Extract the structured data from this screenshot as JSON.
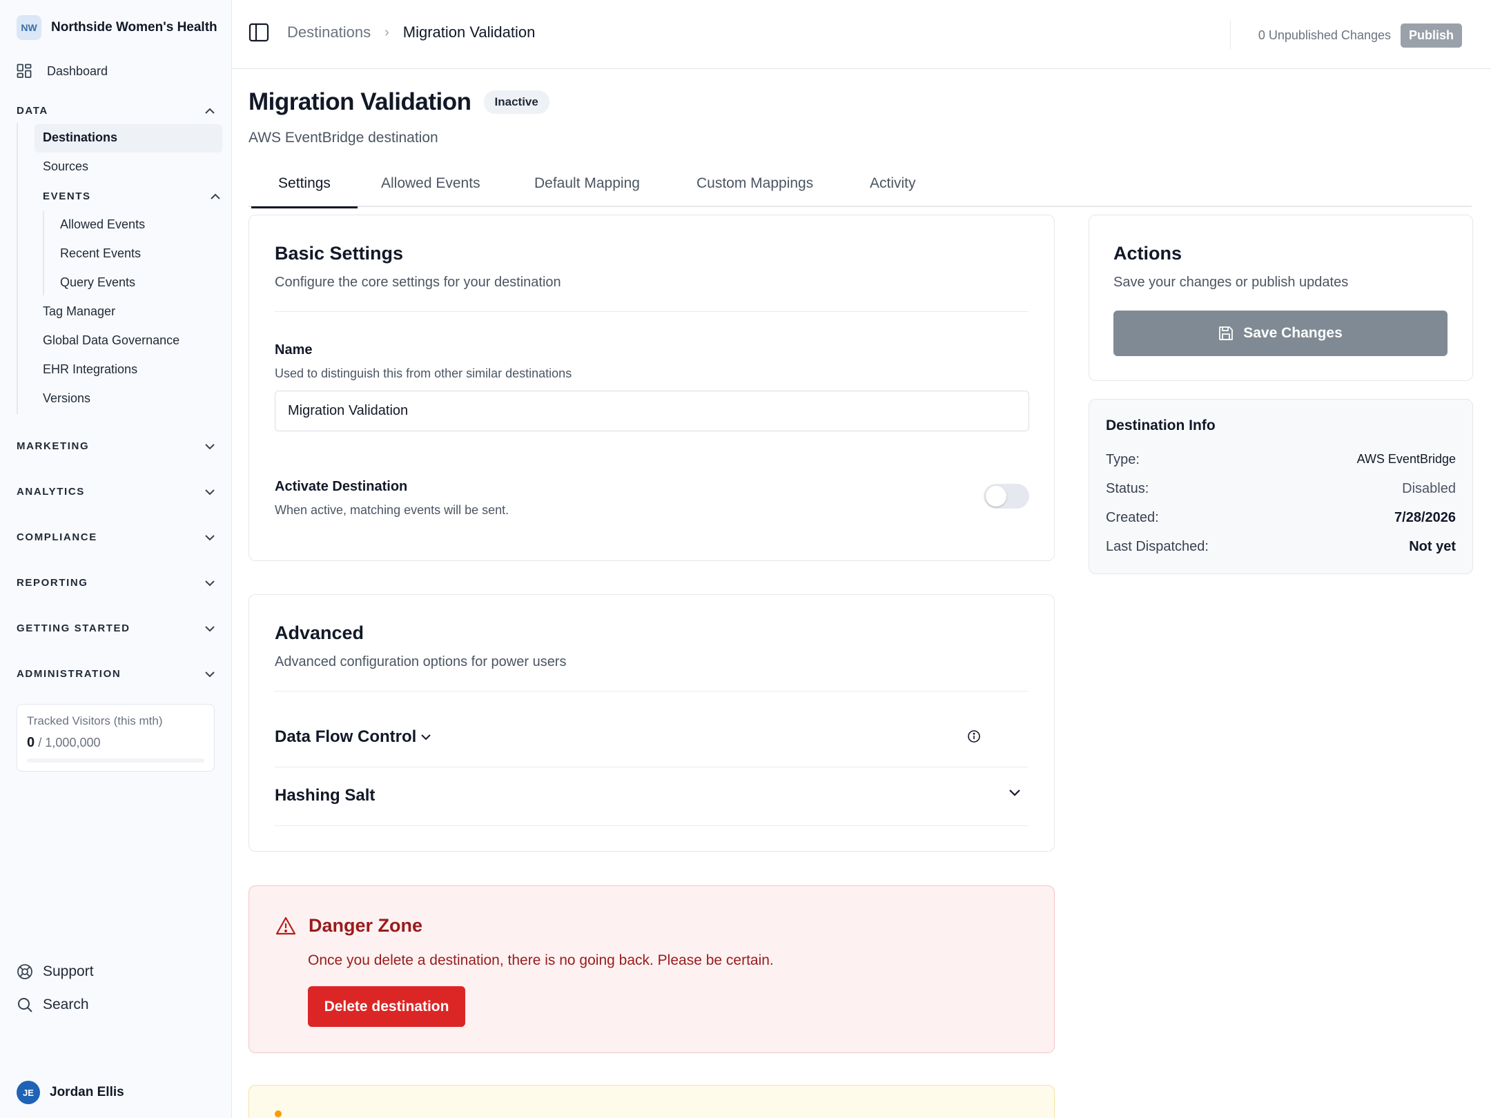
{
  "org": {
    "initials": "NW",
    "name": "Northside Women's Health"
  },
  "sidebar": {
    "dashboard": "Dashboard",
    "data_section": "DATA",
    "data_items": {
      "destinations": "Destinations",
      "sources": "Sources",
      "events_section": "EVENTS",
      "allowed_events": "Allowed Events",
      "recent_events": "Recent Events",
      "query_events": "Query Events",
      "tag_manager": "Tag Manager",
      "global_data_governance": "Global Data Governance",
      "ehr_integrations": "EHR Integrations",
      "versions": "Versions"
    },
    "sections": {
      "marketing": "MARKETING",
      "analytics": "ANALYTICS",
      "compliance": "COMPLIANCE",
      "reporting": "REPORTING",
      "getting_started": "GETTING STARTED",
      "administration": "ADMINISTRATION"
    },
    "visitors": {
      "label": "Tracked Visitors (this mth)",
      "count": "0",
      "limit": "/ 1,000,000",
      "used_fraction": 0
    },
    "support": "Support",
    "search": "Search",
    "user": {
      "initials": "JE",
      "name": "Jordan Ellis"
    }
  },
  "topbar": {
    "breadcrumb_parent": "Destinations",
    "breadcrumb_separator": "›",
    "breadcrumb_current": "Migration Validation",
    "unpublished": "0 Unpublished Changes",
    "publish": "Publish"
  },
  "page": {
    "title": "Migration Validation",
    "status_badge": "Inactive",
    "subtitle": "AWS EventBridge destination"
  },
  "tabs": {
    "settings": "Settings",
    "allowed_events": "Allowed Events",
    "default_mapping": "Default Mapping",
    "custom_mappings": "Custom Mappings",
    "activity": "Activity"
  },
  "basic": {
    "title": "Basic Settings",
    "desc": "Configure the core settings for your destination",
    "name_label": "Name",
    "name_help": "Used to distinguish this from other similar destinations",
    "name_value": "Migration Validation",
    "activate_label": "Activate Destination",
    "activate_help": "When active, matching events will be sent.",
    "activate_on": false
  },
  "advanced": {
    "title": "Advanced",
    "desc": "Advanced configuration options for power users",
    "data_flow": "Data Flow Control",
    "hashing_salt": "Hashing Salt"
  },
  "danger": {
    "title": "Danger Zone",
    "desc": "Once you delete a destination, there is no going back. Please be certain.",
    "delete": "Delete destination"
  },
  "actions": {
    "title": "Actions",
    "desc": "Save your changes or publish updates",
    "save": "Save Changes"
  },
  "info": {
    "title": "Destination Info",
    "type_label": "Type:",
    "type_value": "AWS EventBridge",
    "status_label": "Status:",
    "status_value": "Disabled",
    "created_label": "Created:",
    "created_value": "7/28/2026",
    "last_label": "Last Dispatched:",
    "last_value": "Not yet"
  },
  "colors": {
    "danger": "#dc2626",
    "avatar": "#1e63b5",
    "accent_dark": "#111827"
  }
}
